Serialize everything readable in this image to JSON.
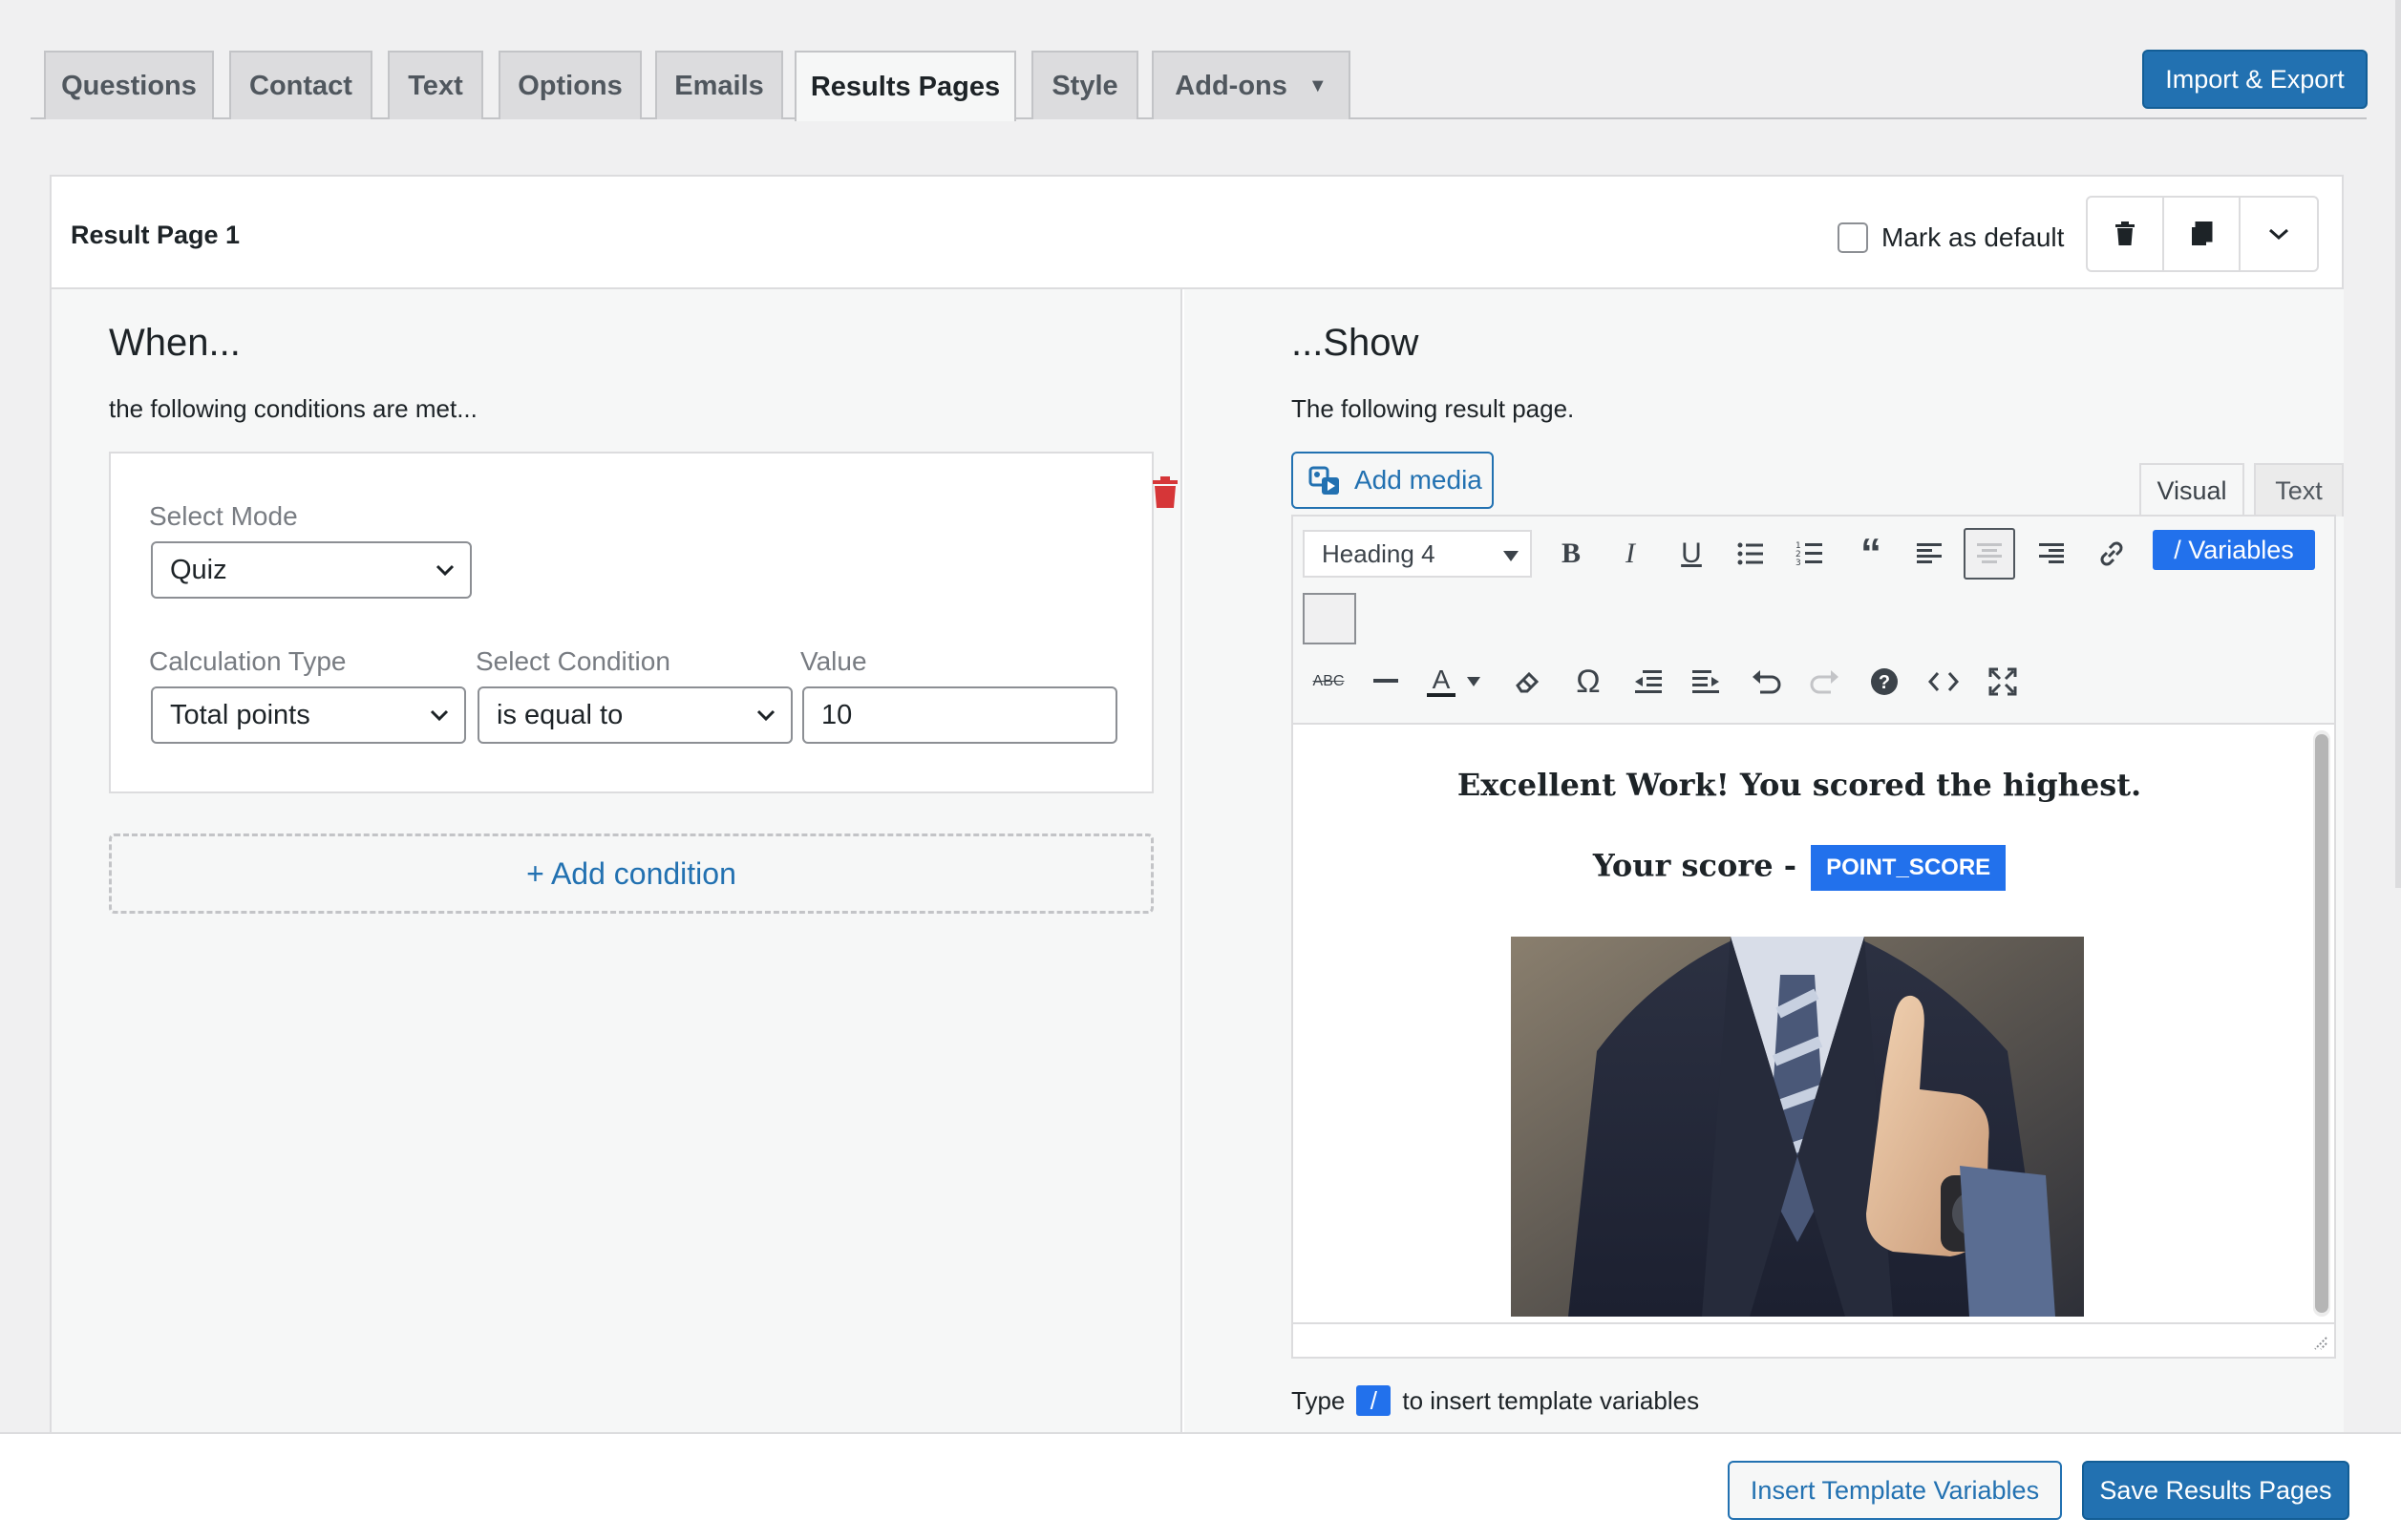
{
  "tabs": [
    {
      "label": "Questions"
    },
    {
      "label": "Contact"
    },
    {
      "label": "Text"
    },
    {
      "label": "Options"
    },
    {
      "label": "Emails"
    },
    {
      "label": "Results Pages",
      "active": true
    },
    {
      "label": "Style"
    },
    {
      "label": "Add-ons"
    }
  ],
  "header": {
    "import_export_label": "Import & Export"
  },
  "result_page": {
    "title": "Result Page 1",
    "mark_default_label": "Mark as default",
    "mark_default_checked": false
  },
  "when": {
    "heading": "When...",
    "subtext": "the following conditions are met...",
    "select_mode_label": "Select Mode",
    "select_mode_value": "Quiz",
    "calc_type_label": "Calculation Type",
    "calc_type_value": "Total points",
    "condition_label": "Select Condition",
    "condition_value": "is equal to",
    "value_label": "Value",
    "value": "10",
    "add_condition_label": "+ Add condition"
  },
  "show": {
    "heading": "...Show",
    "subtext": "The following result page.",
    "add_media_label": "Add media",
    "visual_tab": "Visual",
    "text_tab": "Text",
    "format_select_value": "Heading 4",
    "variables_label": "/ Variables",
    "content_heading1": "Excellent Work! You scored the highest.",
    "content_heading2_prefix": "Your score -",
    "score_variable": "POINT_SCORE",
    "hint_prefix": "Type",
    "hint_slash": "/",
    "hint_suffix": "to insert template variables"
  },
  "footer": {
    "insert_variables_label": "Insert Template Variables",
    "save_label": "Save Results Pages"
  },
  "colors": {
    "primary": "#2271b1",
    "variable_blue": "#2271ec",
    "danger": "#d63638",
    "background": "#f0f0f1"
  }
}
